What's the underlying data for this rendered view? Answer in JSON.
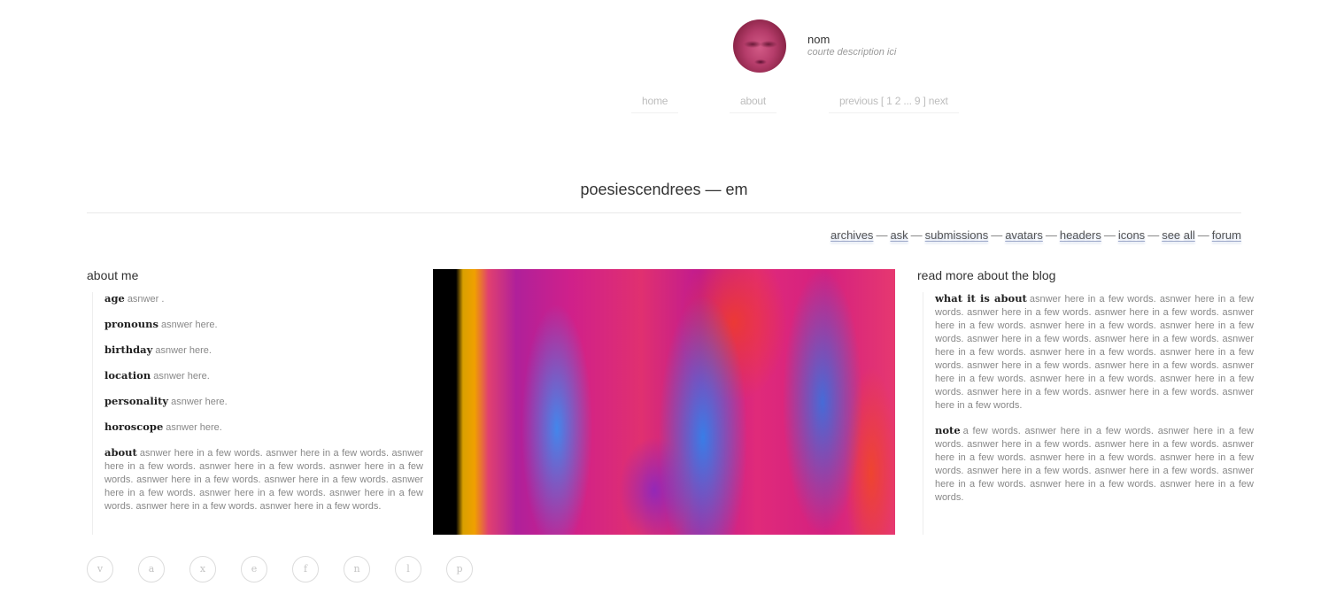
{
  "profile": {
    "name": "nom",
    "description": "courte description ici"
  },
  "nav": {
    "home": "home",
    "about": "about",
    "pagination": "previous [ 1 2 ... 9 ] next"
  },
  "blog_title": "poesiescendrees — em",
  "links": [
    "archives",
    "ask",
    "submissions",
    "avatars",
    "headers",
    "icons",
    "see all",
    "forum"
  ],
  "link_separator": "—",
  "about_me": {
    "heading": "about me",
    "items": [
      {
        "label": "age",
        "value": "asnwer ."
      },
      {
        "label": "pronouns",
        "value": "asnwer here."
      },
      {
        "label": "birthday",
        "value": "asnwer here."
      },
      {
        "label": "location",
        "value": "asnwer here."
      },
      {
        "label": "personality",
        "value": "asnwer here."
      },
      {
        "label": "horoscope",
        "value": "asnwer here."
      },
      {
        "label": "about",
        "value": "asnwer here in a few words. asnwer here in a few words. asnwer here in a few words. asnwer here in a few words. asnwer here in a few words. asnwer here in a few words. asnwer here in a few words. asnwer here in a few words. asnwer here in a few words. asnwer here in a few words. asnwer here in a few words. asnwer here in a few words."
      }
    ]
  },
  "blog_info": {
    "heading": "read more about the blog",
    "items": [
      {
        "label": "what it is about",
        "value": "asnwer here in a few words. asnwer here in a few words. asnwer here in a few words. asnwer here in a few words. asnwer here in a few words. asnwer here in a few words. asnwer here in a few words. asnwer here in a few words. asnwer here in a few words. asnwer here in a few words. asnwer here in a few words. asnwer here in a few words. asnwer here in a few words. asnwer here in a few words. asnwer here in a few words. asnwer here in a few words. asnwer here in a few words. asnwer here in a few words. asnwer here in a few words. asnwer here in a few words."
      },
      {
        "label": "note",
        "value": "a few words. asnwer here in a few words. asnwer here in a few words. asnwer here in a few words. asnwer here in a few words. asnwer here in a few words. asnwer here in a few words. asnwer here in a few words. asnwer here in a few words. asnwer here in a few words. asnwer here in a few words. asnwer here in a few words. asnwer here in a few words."
      }
    ]
  },
  "social": [
    "v",
    "a",
    "x",
    "e",
    "f",
    "n",
    "l",
    "p"
  ]
}
